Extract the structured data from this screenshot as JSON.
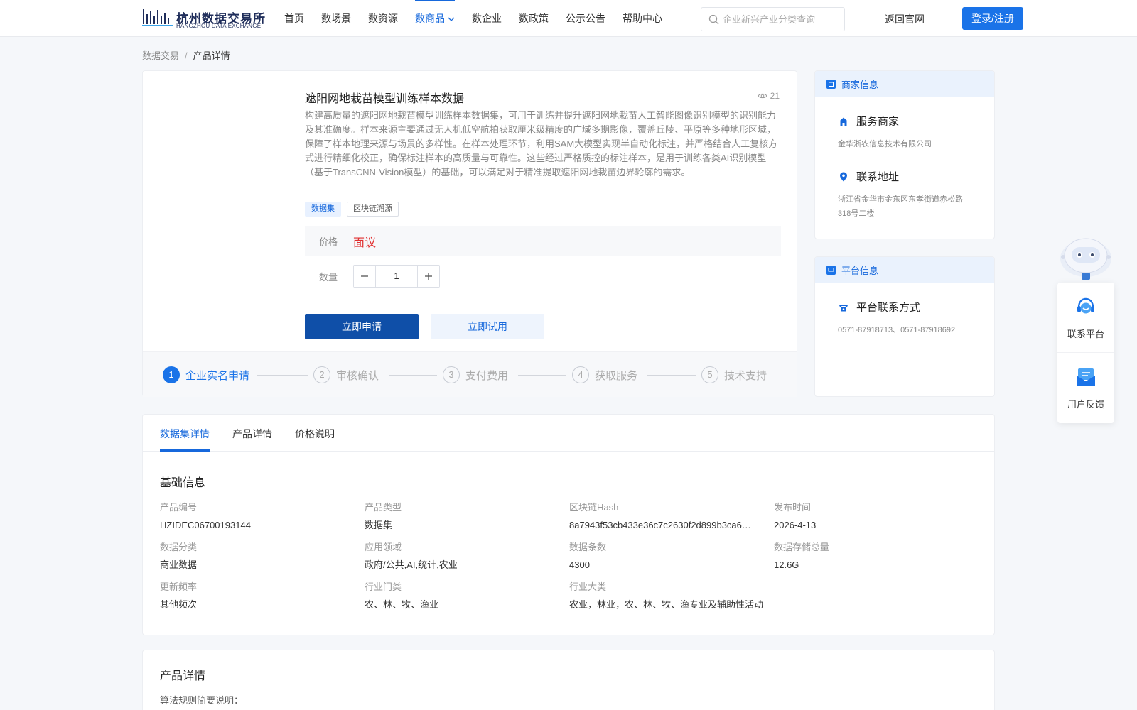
{
  "header": {
    "logo_cn": "杭州数据交易所",
    "logo_en": "HANGZHOU DATA EXCHANGE",
    "nav": [
      {
        "label": "首页",
        "active": false
      },
      {
        "label": "数场景",
        "active": false
      },
      {
        "label": "数资源",
        "active": false
      },
      {
        "label": "数商品",
        "active": true
      },
      {
        "label": "数企业",
        "active": false
      },
      {
        "label": "数政策",
        "active": false
      },
      {
        "label": "公示公告",
        "active": false
      },
      {
        "label": "帮助中心",
        "active": false
      }
    ],
    "search_placeholder": "企业新兴产业分类查询",
    "back_link": "返回官网",
    "login_label": "登录/注册"
  },
  "breadcrumb": {
    "root": "数据交易",
    "sep": "/",
    "current": "产品详情"
  },
  "product": {
    "title": "遮阳网地栽苗模型训练样本数据",
    "views": "21",
    "description": "构建高质量的遮阳网地栽苗模型训练样本数据集，可用于训练并提升遮阳网地栽苗人工智能图像识别模型的识别能力及其准确度。样本来源主要通过无人机低空航拍获取厘米级精度的广域多期影像，覆盖丘陵、平原等多种地形区域，保障了样本地理来源与场景的多样性。在样本处理环节，利用SAM大模型实现半自动化标注，并严格结合人工复核方式进行精细化校正，确保标注样本的高质量与可靠性。这些经过严格质控的标注样本，是用于训练各类AI识别模型（基于TransCNN-Vision模型）的基础，可以满足对于精准提取遮阳网地栽苗边界轮廓的需求。",
    "tags": [
      "数据集",
      "区块链溯源"
    ],
    "price_label": "价格",
    "price_value": "面议",
    "qty_label": "数量",
    "qty_value": "1",
    "apply_label": "立即申请",
    "trial_label": "立即试用",
    "steps": [
      {
        "num": "1",
        "label": "企业实名申请",
        "active": true
      },
      {
        "num": "2",
        "label": "审核确认",
        "active": false
      },
      {
        "num": "3",
        "label": "支付费用",
        "active": false
      },
      {
        "num": "4",
        "label": "获取服务",
        "active": false
      },
      {
        "num": "5",
        "label": "技术支持",
        "active": false
      }
    ]
  },
  "merchant": {
    "head": "商家信息",
    "service_title": "服务商家",
    "service_value": "金华浙农信息技术有限公司",
    "addr_title": "联系地址",
    "addr_value": "浙江省金华市金东区东孝街道赤松路318号二楼"
  },
  "platform": {
    "head": "平台信息",
    "contact_title": "平台联系方式",
    "contact_value": "0571-87918713、0571-87918692"
  },
  "float": {
    "contact_label": "联系平台",
    "feedback_label": "用户反馈"
  },
  "tabs": [
    {
      "label": "数据集详情",
      "active": true
    },
    {
      "label": "产品详情",
      "active": false
    },
    {
      "label": "价格说明",
      "active": false
    }
  ],
  "basic": {
    "title": "基础信息",
    "fields": [
      {
        "label": "产品编号",
        "value": "HZIDEC06700193144"
      },
      {
        "label": "产品类型",
        "value": "数据集"
      },
      {
        "label": "区块链Hash",
        "value": "8a7943f53cb433e36c7c2630f2d899b3ca6…"
      },
      {
        "label": "发布时间",
        "value": "2026-4-13"
      },
      {
        "label": "数据分类",
        "value": "商业数据"
      },
      {
        "label": "应用领域",
        "value": "政府/公共,AI,统计,农业"
      },
      {
        "label": "数据条数",
        "value": "4300"
      },
      {
        "label": "数据存储总量",
        "value": "12.6G"
      },
      {
        "label": "更新频率",
        "value": "其他频次"
      },
      {
        "label": "行业门类",
        "value": "农、林、牧、渔业"
      },
      {
        "label": "行业大类",
        "value": "农业，林业，农、林、牧、渔专业及辅助性活动"
      }
    ]
  },
  "detail": {
    "title": "产品详情",
    "sub": "算法规则简要说明："
  },
  "colors": {
    "primary": "#1a73e8",
    "apply_button": "#0f4fa8",
    "price": "#e02e2e"
  }
}
